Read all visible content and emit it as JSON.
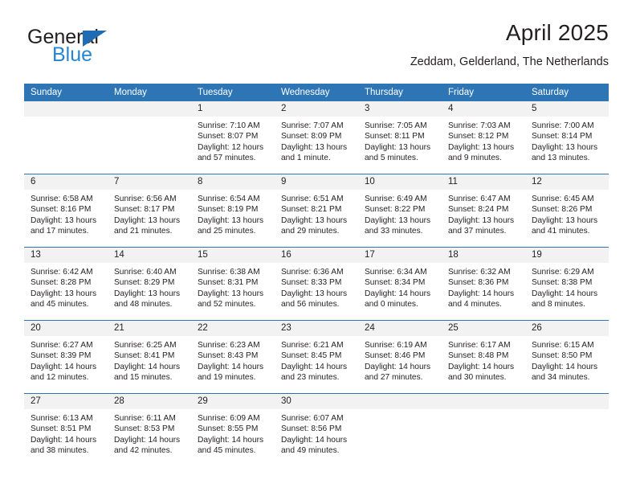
{
  "brand": {
    "name_top": "General",
    "name_bottom": "Blue",
    "accent_color": "#2585d3",
    "triangle_color": "#1f6cb5"
  },
  "header": {
    "title": "April 2025",
    "subtitle": "Zeddam, Gelderland, The Netherlands"
  },
  "theme": {
    "header_row_bg": "#2e75b6",
    "header_row_text": "#ffffff",
    "daynum_band_bg": "#f2f2f2",
    "row_divider": "#2e75b6",
    "text": "#231f20"
  },
  "weekday_headers": [
    "Sunday",
    "Monday",
    "Tuesday",
    "Wednesday",
    "Thursday",
    "Friday",
    "Saturday"
  ],
  "weeks": [
    [
      {
        "day": "",
        "lines": []
      },
      {
        "day": "",
        "lines": []
      },
      {
        "day": "1",
        "lines": [
          "Sunrise: 7:10 AM",
          "Sunset: 8:07 PM",
          "Daylight: 12 hours",
          "and 57 minutes."
        ]
      },
      {
        "day": "2",
        "lines": [
          "Sunrise: 7:07 AM",
          "Sunset: 8:09 PM",
          "Daylight: 13 hours",
          "and 1 minute."
        ]
      },
      {
        "day": "3",
        "lines": [
          "Sunrise: 7:05 AM",
          "Sunset: 8:11 PM",
          "Daylight: 13 hours",
          "and 5 minutes."
        ]
      },
      {
        "day": "4",
        "lines": [
          "Sunrise: 7:03 AM",
          "Sunset: 8:12 PM",
          "Daylight: 13 hours",
          "and 9 minutes."
        ]
      },
      {
        "day": "5",
        "lines": [
          "Sunrise: 7:00 AM",
          "Sunset: 8:14 PM",
          "Daylight: 13 hours",
          "and 13 minutes."
        ]
      }
    ],
    [
      {
        "day": "6",
        "lines": [
          "Sunrise: 6:58 AM",
          "Sunset: 8:16 PM",
          "Daylight: 13 hours",
          "and 17 minutes."
        ]
      },
      {
        "day": "7",
        "lines": [
          "Sunrise: 6:56 AM",
          "Sunset: 8:17 PM",
          "Daylight: 13 hours",
          "and 21 minutes."
        ]
      },
      {
        "day": "8",
        "lines": [
          "Sunrise: 6:54 AM",
          "Sunset: 8:19 PM",
          "Daylight: 13 hours",
          "and 25 minutes."
        ]
      },
      {
        "day": "9",
        "lines": [
          "Sunrise: 6:51 AM",
          "Sunset: 8:21 PM",
          "Daylight: 13 hours",
          "and 29 minutes."
        ]
      },
      {
        "day": "10",
        "lines": [
          "Sunrise: 6:49 AM",
          "Sunset: 8:22 PM",
          "Daylight: 13 hours",
          "and 33 minutes."
        ]
      },
      {
        "day": "11",
        "lines": [
          "Sunrise: 6:47 AM",
          "Sunset: 8:24 PM",
          "Daylight: 13 hours",
          "and 37 minutes."
        ]
      },
      {
        "day": "12",
        "lines": [
          "Sunrise: 6:45 AM",
          "Sunset: 8:26 PM",
          "Daylight: 13 hours",
          "and 41 minutes."
        ]
      }
    ],
    [
      {
        "day": "13",
        "lines": [
          "Sunrise: 6:42 AM",
          "Sunset: 8:28 PM",
          "Daylight: 13 hours",
          "and 45 minutes."
        ]
      },
      {
        "day": "14",
        "lines": [
          "Sunrise: 6:40 AM",
          "Sunset: 8:29 PM",
          "Daylight: 13 hours",
          "and 48 minutes."
        ]
      },
      {
        "day": "15",
        "lines": [
          "Sunrise: 6:38 AM",
          "Sunset: 8:31 PM",
          "Daylight: 13 hours",
          "and 52 minutes."
        ]
      },
      {
        "day": "16",
        "lines": [
          "Sunrise: 6:36 AM",
          "Sunset: 8:33 PM",
          "Daylight: 13 hours",
          "and 56 minutes."
        ]
      },
      {
        "day": "17",
        "lines": [
          "Sunrise: 6:34 AM",
          "Sunset: 8:34 PM",
          "Daylight: 14 hours",
          "and 0 minutes."
        ]
      },
      {
        "day": "18",
        "lines": [
          "Sunrise: 6:32 AM",
          "Sunset: 8:36 PM",
          "Daylight: 14 hours",
          "and 4 minutes."
        ]
      },
      {
        "day": "19",
        "lines": [
          "Sunrise: 6:29 AM",
          "Sunset: 8:38 PM",
          "Daylight: 14 hours",
          "and 8 minutes."
        ]
      }
    ],
    [
      {
        "day": "20",
        "lines": [
          "Sunrise: 6:27 AM",
          "Sunset: 8:39 PM",
          "Daylight: 14 hours",
          "and 12 minutes."
        ]
      },
      {
        "day": "21",
        "lines": [
          "Sunrise: 6:25 AM",
          "Sunset: 8:41 PM",
          "Daylight: 14 hours",
          "and 15 minutes."
        ]
      },
      {
        "day": "22",
        "lines": [
          "Sunrise: 6:23 AM",
          "Sunset: 8:43 PM",
          "Daylight: 14 hours",
          "and 19 minutes."
        ]
      },
      {
        "day": "23",
        "lines": [
          "Sunrise: 6:21 AM",
          "Sunset: 8:45 PM",
          "Daylight: 14 hours",
          "and 23 minutes."
        ]
      },
      {
        "day": "24",
        "lines": [
          "Sunrise: 6:19 AM",
          "Sunset: 8:46 PM",
          "Daylight: 14 hours",
          "and 27 minutes."
        ]
      },
      {
        "day": "25",
        "lines": [
          "Sunrise: 6:17 AM",
          "Sunset: 8:48 PM",
          "Daylight: 14 hours",
          "and 30 minutes."
        ]
      },
      {
        "day": "26",
        "lines": [
          "Sunrise: 6:15 AM",
          "Sunset: 8:50 PM",
          "Daylight: 14 hours",
          "and 34 minutes."
        ]
      }
    ],
    [
      {
        "day": "27",
        "lines": [
          "Sunrise: 6:13 AM",
          "Sunset: 8:51 PM",
          "Daylight: 14 hours",
          "and 38 minutes."
        ]
      },
      {
        "day": "28",
        "lines": [
          "Sunrise: 6:11 AM",
          "Sunset: 8:53 PM",
          "Daylight: 14 hours",
          "and 42 minutes."
        ]
      },
      {
        "day": "29",
        "lines": [
          "Sunrise: 6:09 AM",
          "Sunset: 8:55 PM",
          "Daylight: 14 hours",
          "and 45 minutes."
        ]
      },
      {
        "day": "30",
        "lines": [
          "Sunrise: 6:07 AM",
          "Sunset: 8:56 PM",
          "Daylight: 14 hours",
          "and 49 minutes."
        ]
      },
      {
        "day": "",
        "lines": []
      },
      {
        "day": "",
        "lines": []
      },
      {
        "day": "",
        "lines": []
      }
    ]
  ]
}
